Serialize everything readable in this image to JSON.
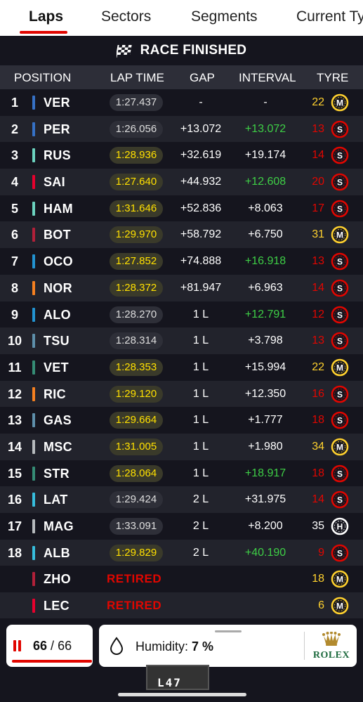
{
  "tabs": [
    {
      "label": "Laps",
      "active": true
    },
    {
      "label": "Sectors",
      "active": false
    },
    {
      "label": "Segments",
      "active": false
    },
    {
      "label": "Current Ty",
      "active": false
    }
  ],
  "banner": {
    "text": "RACE FINISHED",
    "icon": "chequered-flag-icon"
  },
  "header": {
    "position": "POSITION",
    "lap_time": "LAP TIME",
    "gap": "GAP",
    "interval": "INTERVAL",
    "tyre": "TYRE"
  },
  "colors": {
    "accent": "#e10600",
    "fastest": "#ffe000",
    "green": "#3ecf46",
    "soft": "#e10600",
    "medium": "#ffd12e",
    "hard": "#ffffff"
  },
  "rows": [
    {
      "pos": "1",
      "driver": "VER",
      "team_color": "#3671c6",
      "lap_time": "1:27.437",
      "fast": false,
      "gap": "-",
      "interval": "-",
      "interval_green": false,
      "tyre_laps": "22",
      "tyre": "M"
    },
    {
      "pos": "2",
      "driver": "PER",
      "team_color": "#3671c6",
      "lap_time": "1:26.056",
      "fast": false,
      "gap": "+13.072",
      "interval": "+13.072",
      "interval_green": true,
      "tyre_laps": "13",
      "tyre": "S"
    },
    {
      "pos": "3",
      "driver": "RUS",
      "team_color": "#6cd3bf",
      "lap_time": "1:28.936",
      "fast": true,
      "gap": "+32.619",
      "interval": "+19.174",
      "interval_green": false,
      "tyre_laps": "14",
      "tyre": "S"
    },
    {
      "pos": "4",
      "driver": "SAI",
      "team_color": "#e8002d",
      "lap_time": "1:27.640",
      "fast": true,
      "gap": "+44.932",
      "interval": "+12.608",
      "interval_green": true,
      "tyre_laps": "20",
      "tyre": "S"
    },
    {
      "pos": "5",
      "driver": "HAM",
      "team_color": "#6cd3bf",
      "lap_time": "1:31.646",
      "fast": true,
      "gap": "+52.836",
      "interval": "+8.063",
      "interval_green": false,
      "tyre_laps": "17",
      "tyre": "S"
    },
    {
      "pos": "6",
      "driver": "BOT",
      "team_color": "#b12039",
      "lap_time": "1:29.970",
      "fast": true,
      "gap": "+58.792",
      "interval": "+6.750",
      "interval_green": false,
      "tyre_laps": "31",
      "tyre": "M"
    },
    {
      "pos": "7",
      "driver": "OCO",
      "team_color": "#2293d1",
      "lap_time": "1:27.852",
      "fast": true,
      "gap": "+74.888",
      "interval": "+16.918",
      "interval_green": true,
      "tyre_laps": "13",
      "tyre": "S"
    },
    {
      "pos": "8",
      "driver": "NOR",
      "team_color": "#f58020",
      "lap_time": "1:28.372",
      "fast": true,
      "gap": "+81.947",
      "interval": "+6.963",
      "interval_green": false,
      "tyre_laps": "14",
      "tyre": "S"
    },
    {
      "pos": "9",
      "driver": "ALO",
      "team_color": "#2293d1",
      "lap_time": "1:28.270",
      "fast": false,
      "gap": "1 L",
      "interval": "+12.791",
      "interval_green": true,
      "tyre_laps": "12",
      "tyre": "S"
    },
    {
      "pos": "10",
      "driver": "TSU",
      "team_color": "#5e8faa",
      "lap_time": "1:28.314",
      "fast": false,
      "gap": "1 L",
      "interval": "+3.798",
      "interval_green": false,
      "tyre_laps": "13",
      "tyre": "S"
    },
    {
      "pos": "11",
      "driver": "VET",
      "team_color": "#358c75",
      "lap_time": "1:28.353",
      "fast": true,
      "gap": "1 L",
      "interval": "+15.994",
      "interval_green": false,
      "tyre_laps": "22",
      "tyre": "M"
    },
    {
      "pos": "12",
      "driver": "RIC",
      "team_color": "#f58020",
      "lap_time": "1:29.120",
      "fast": true,
      "gap": "1 L",
      "interval": "+12.350",
      "interval_green": false,
      "tyre_laps": "16",
      "tyre": "S"
    },
    {
      "pos": "13",
      "driver": "GAS",
      "team_color": "#5e8faa",
      "lap_time": "1:29.664",
      "fast": true,
      "gap": "1 L",
      "interval": "+1.777",
      "interval_green": false,
      "tyre_laps": "18",
      "tyre": "S"
    },
    {
      "pos": "14",
      "driver": "MSC",
      "team_color": "#b6babd",
      "lap_time": "1:31.005",
      "fast": true,
      "gap": "1 L",
      "interval": "+1.980",
      "interval_green": false,
      "tyre_laps": "34",
      "tyre": "M"
    },
    {
      "pos": "15",
      "driver": "STR",
      "team_color": "#358c75",
      "lap_time": "1:28.064",
      "fast": true,
      "gap": "1 L",
      "interval": "+18.917",
      "interval_green": true,
      "tyre_laps": "18",
      "tyre": "S"
    },
    {
      "pos": "16",
      "driver": "LAT",
      "team_color": "#37bedd",
      "lap_time": "1:29.424",
      "fast": false,
      "gap": "2 L",
      "interval": "+31.975",
      "interval_green": false,
      "tyre_laps": "14",
      "tyre": "S"
    },
    {
      "pos": "17",
      "driver": "MAG",
      "team_color": "#b6babd",
      "lap_time": "1:33.091",
      "fast": false,
      "gap": "2 L",
      "interval": "+8.200",
      "interval_green": false,
      "tyre_laps": "35",
      "tyre": "H"
    },
    {
      "pos": "18",
      "driver": "ALB",
      "team_color": "#37bedd",
      "lap_time": "1:29.829",
      "fast": true,
      "gap": "2 L",
      "interval": "+40.190",
      "interval_green": true,
      "tyre_laps": "9",
      "tyre": "S"
    },
    {
      "pos": "",
      "driver": "ZHO",
      "team_color": "#b12039",
      "retired": "RETIRED",
      "gap": "",
      "interval": "",
      "interval_green": false,
      "tyre_laps": "18",
      "tyre": "M"
    },
    {
      "pos": "",
      "driver": "LEC",
      "team_color": "#e8002d",
      "retired": "RETIRED",
      "gap": "",
      "interval": "",
      "interval_green": false,
      "tyre_laps": "6",
      "tyre": "M"
    }
  ],
  "footer": {
    "laps_current": "66",
    "laps_sep": "/",
    "laps_total": "66",
    "lap_progress": 1.0,
    "humidity_label": "Humidity:",
    "humidity_value": "7 %",
    "sponsor": "ROLEX",
    "board_text": "L47"
  }
}
